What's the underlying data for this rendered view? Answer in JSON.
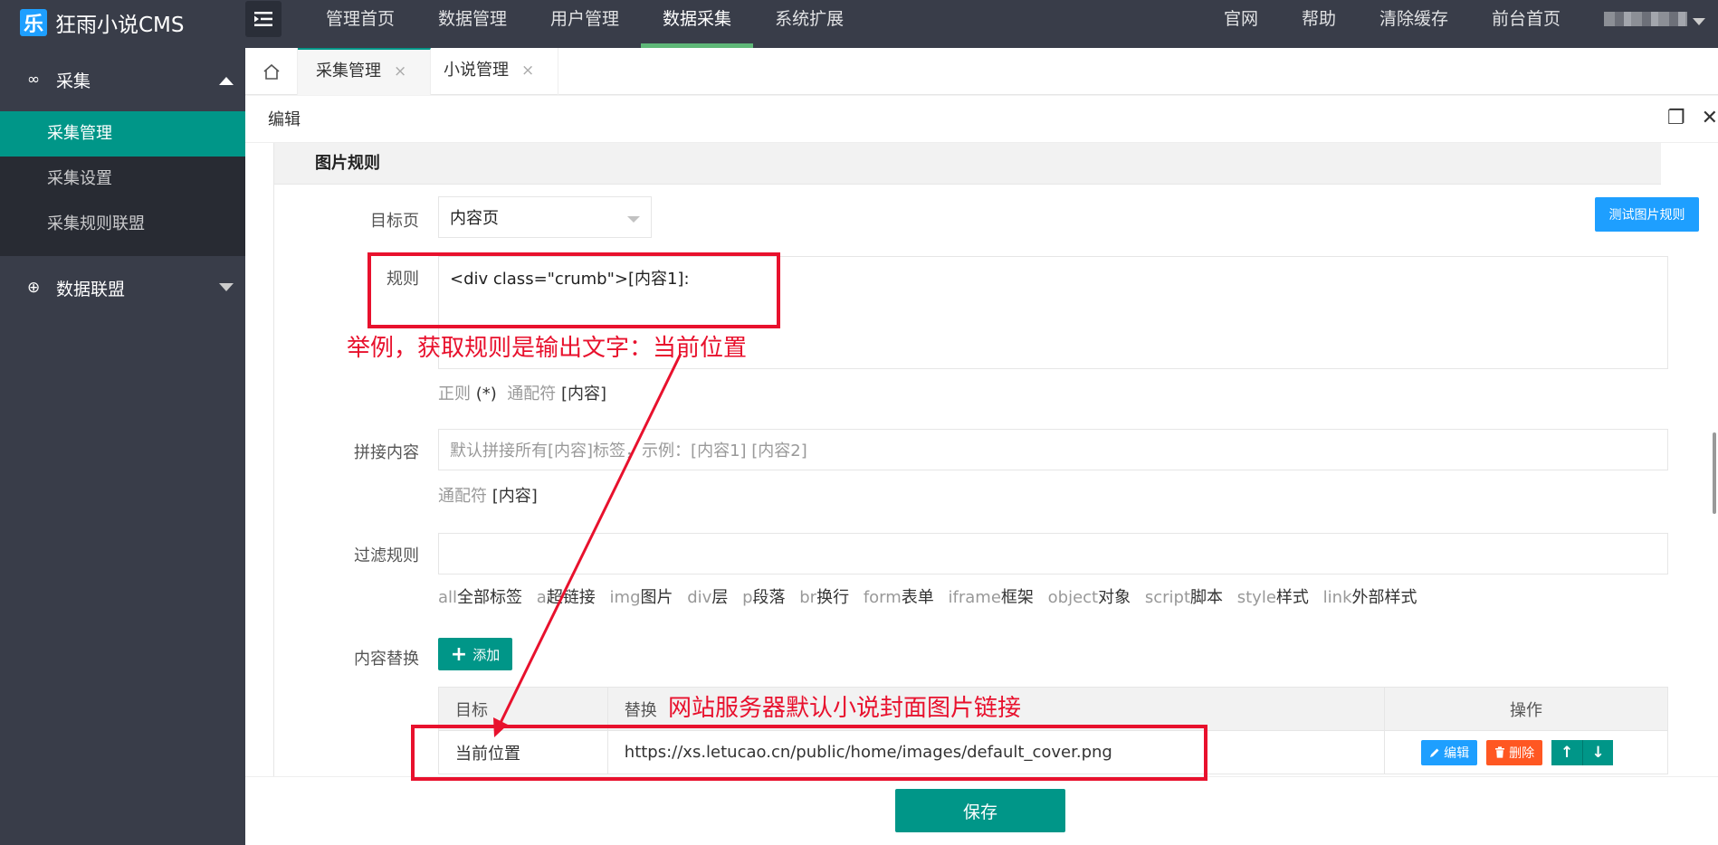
{
  "brand": {
    "logo_char": "乐",
    "name": "狂雨小说CMS"
  },
  "top_nav": [
    "管理首页",
    "数据管理",
    "用户管理",
    "数据采集",
    "系统扩展"
  ],
  "top_nav_active": "数据采集",
  "right_nav": [
    "官网",
    "帮助",
    "清除缓存",
    "前台首页"
  ],
  "sidebar": {
    "group1": {
      "icon": "∞",
      "label": "采集",
      "items": [
        "采集管理",
        "采集设置",
        "采集规则联盟"
      ]
    },
    "group2": {
      "icon": "⊕",
      "label": "数据联盟"
    }
  },
  "tabs": [
    {
      "label": "采集管理",
      "close": "×"
    },
    {
      "label": "小说管理",
      "close": "×"
    }
  ],
  "panel": {
    "title": "编辑",
    "maximize": "❐",
    "close": "✕"
  },
  "card": {
    "title": "图片规则"
  },
  "form": {
    "target_label": "目标页",
    "target_value": "内容页",
    "test_button": "测试图片规则",
    "rule_label": "规则",
    "rule_value": "<div class=\"crumb\">[内容1]:",
    "rule_hint": {
      "regex": "正则",
      "regex_sym": "(*)",
      "wild": "通配符",
      "wild_sym": "[内容]"
    },
    "concat_label": "拼接内容",
    "concat_placeholder": "默认拼接所有[内容]标签，示例：[内容1] [内容2]",
    "concat_hint": {
      "wild": "通配符",
      "wild_sym": "[内容]"
    },
    "filter_label": "过滤规则",
    "filter_tags": [
      {
        "tag": "all",
        "desc": "全部标签"
      },
      {
        "tag": "a",
        "desc": "超链接"
      },
      {
        "tag": "img",
        "desc": "图片"
      },
      {
        "tag": "div",
        "desc": "层"
      },
      {
        "tag": "p",
        "desc": "段落"
      },
      {
        "tag": "br",
        "desc": "换行"
      },
      {
        "tag": "form",
        "desc": "表单"
      },
      {
        "tag": "iframe",
        "desc": "框架"
      },
      {
        "tag": "object",
        "desc": "对象"
      },
      {
        "tag": "script",
        "desc": "脚本"
      },
      {
        "tag": "style",
        "desc": "样式"
      },
      {
        "tag": "link",
        "desc": "外部样式"
      }
    ],
    "replace_label": "内容替换",
    "add_button": "添加"
  },
  "table": {
    "headers": [
      "目标",
      "替换",
      "操作"
    ],
    "row": {
      "target": "当前位置",
      "replace": "https://xs.letucao.cn/public/home/images/default_cover.png",
      "edit": "编辑",
      "delete": "删除",
      "up": "↑",
      "down": "↓"
    }
  },
  "save_button": "保存",
  "annotations": {
    "note1": "举例，获取规则是输出文字：当前位置",
    "note2": "网站服务器默认小说封面图片链接",
    "color": "#e8112d"
  },
  "colors": {
    "accent": "#009688",
    "blue": "#1e9fff",
    "danger": "#ff5722",
    "dark": "#393d49"
  }
}
